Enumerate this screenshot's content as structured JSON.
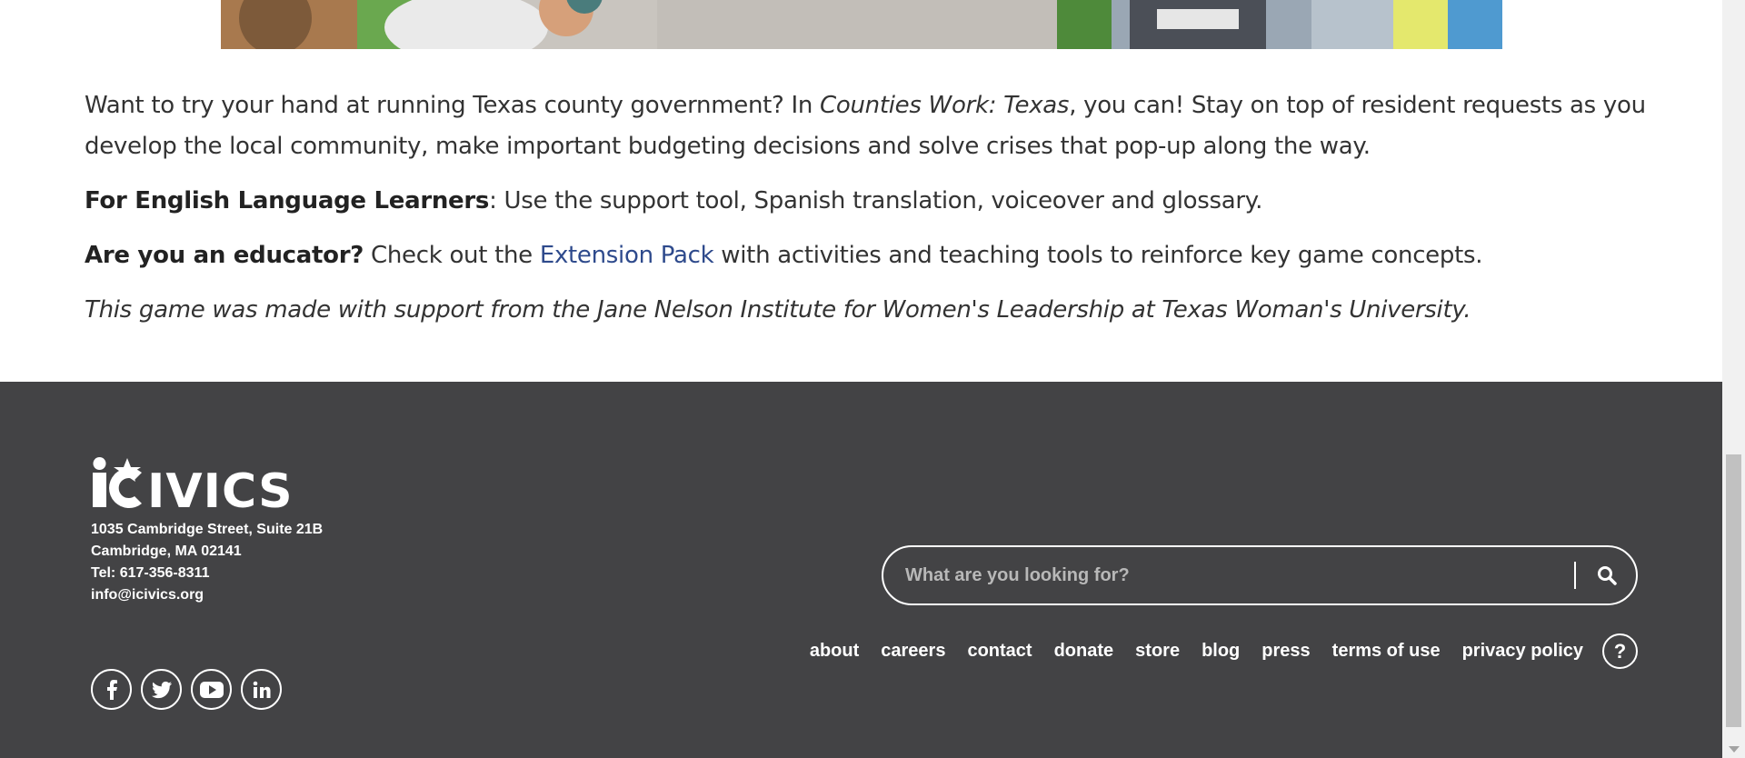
{
  "article": {
    "p1_before": "Want to try your hand at running Texas county government? In ",
    "p1_italic": "Counties Work: Texas",
    "p1_after": ", you can! Stay on top of resident requests as you develop the local community, make important budgeting decisions and solve crises that pop-up along the way.",
    "p2_bold": "For English Language Learners",
    "p2_rest": ": Use the support tool, Spanish translation, voiceover and glossary.",
    "p3_bold": "Are you an educator?",
    "p3_before_link": " Check out the ",
    "p3_link": "Extension Pack",
    "p3_after_link": " with activities and teaching tools to reinforce key game concepts.",
    "p4_italic": "This game was made with support from the Jane Nelson Institute for Women's Leadership at Texas Woman's University."
  },
  "footer": {
    "logo_text": "iCivics",
    "address": {
      "line1": "1035 Cambridge Street, Suite 21B",
      "line2": "Cambridge, MA 02141",
      "phone": "Tel: 617-356-8311",
      "email": "info@icivics.org"
    },
    "social": [
      "facebook-icon",
      "twitter-icon",
      "youtube-icon",
      "linkedin-icon"
    ],
    "search": {
      "placeholder": "What are you looking for?"
    },
    "nav": {
      "about": "about",
      "careers": "careers",
      "contact": "contact",
      "donate": "donate",
      "store": "store",
      "blog": "blog",
      "press": "press",
      "terms": "terms of use",
      "privacy": "privacy policy",
      "help": "?"
    }
  },
  "colors": {
    "footer_bg": "#434345",
    "link": "#2e4a8c",
    "text": "#333333"
  }
}
